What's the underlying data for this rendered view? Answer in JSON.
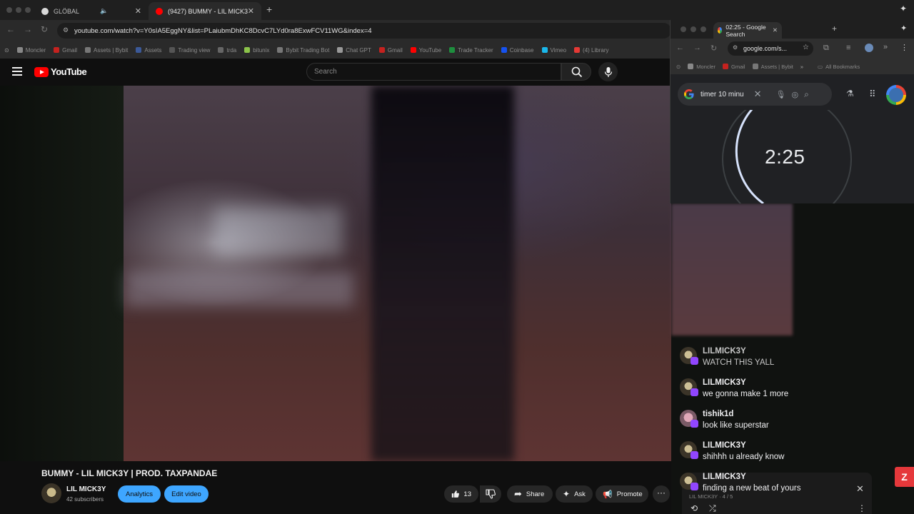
{
  "browser": {
    "tabs": [
      {
        "title": "GLÖBAL"
      },
      {
        "title": "(9427) BUMMY - LIL MICK3Y"
      }
    ],
    "url": "youtube.com/watch?v=Y0sIA5EggNY&list=PLaiubmDhKC8DcvC7LYd0ra8ExwFCV11WG&index=4",
    "bookmarks": [
      "Moncler",
      "Gmail",
      "Assets | Bybit",
      "Assets",
      "Trading view",
      "trda",
      "bitunix",
      "Bybit Trading Bot",
      "Chat GPT",
      "Gmail",
      "YouTube",
      "Trade Tracker",
      "Coinbase",
      "Vimeo",
      "(4) Library"
    ]
  },
  "youtube": {
    "logo": "YouTube",
    "search_placeholder": "Search",
    "video_title": "BUMMY - LIL MICK3Y | PROD. TAXPANDAE",
    "channel_name": "LIL MICK3Y",
    "subscribers": "42 subscribers",
    "analytics_label": "Analytics",
    "edit_video_label": "Edit video",
    "likes": "13",
    "share_label": "Share",
    "ask_label": "Ask",
    "promote_label": "Promote"
  },
  "google_window": {
    "tab_title": "02:25 - Google Search",
    "url": "google.com/s...",
    "bookmarks": [
      "Moncler",
      "Gmail",
      "Assets | Bybit"
    ],
    "all_bookmarks": "All Bookmarks",
    "search_query": "timer 10 minu",
    "timer": "2:25"
  },
  "chat": [
    {
      "user": "LILMICK3Y",
      "message": "WATCH THIS YALL"
    },
    {
      "user": "LILMICK3Y",
      "message": "we gonna make 1 more"
    },
    {
      "user": "tishik1d",
      "message": "look like superstar"
    },
    {
      "user": "LILMICK3Y",
      "message": "shihhh u already know"
    },
    {
      "user": "LILMICK3Y",
      "message": "finding a new beat of yours"
    }
  ],
  "miniplayer": {
    "subtitle": "LIL MICK3Y · 4 / 5"
  }
}
